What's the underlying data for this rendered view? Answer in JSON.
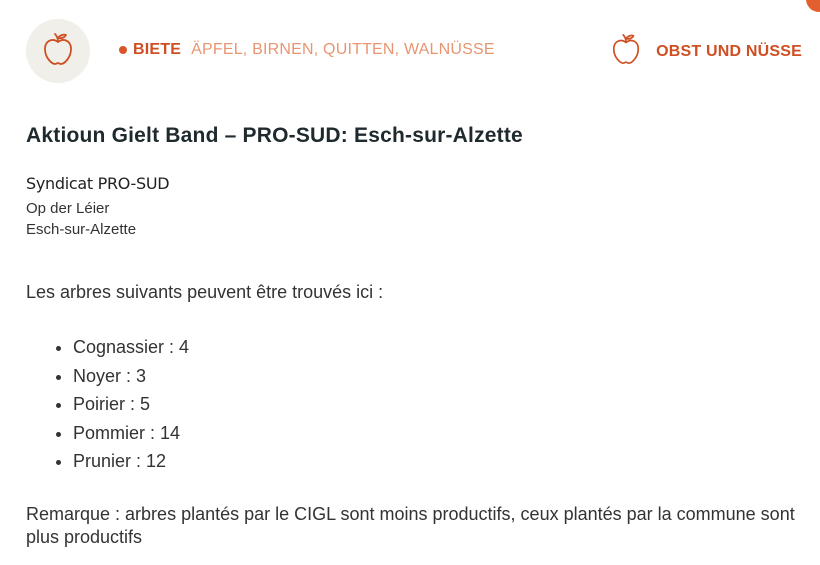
{
  "header": {
    "offer_label": "BIETE",
    "offer_items": "ÄPFEL, BIRNEN, QUITTEN, WALNÜSSE",
    "category_label": "OBST UND NÜSSE",
    "logo_icon": "apple-icon",
    "category_icon": "apple-icon"
  },
  "listing": {
    "title": "Aktioun Gielt Band – PRO-SUD: Esch-sur-Alzette",
    "org_name": "Syndicat PRO-SUD",
    "address_line1": "Op der Léier",
    "address_line2": "Esch-sur-Alzette",
    "intro": "Les arbres suivants peuvent être trouvés ici :",
    "trees": [
      "Cognassier : 4",
      "Noyer : 3",
      "Poirier : 5",
      "Pommier : 14",
      "Prunier : 12"
    ],
    "remark": "Remarque : arbres plantés par le CIGL sont moins productifs, ceux plantés par la commune sont plus productifs"
  },
  "colors": {
    "accent": "#cf4f22",
    "accent_light": "#e89572",
    "logo_bg": "#f1efe9"
  }
}
